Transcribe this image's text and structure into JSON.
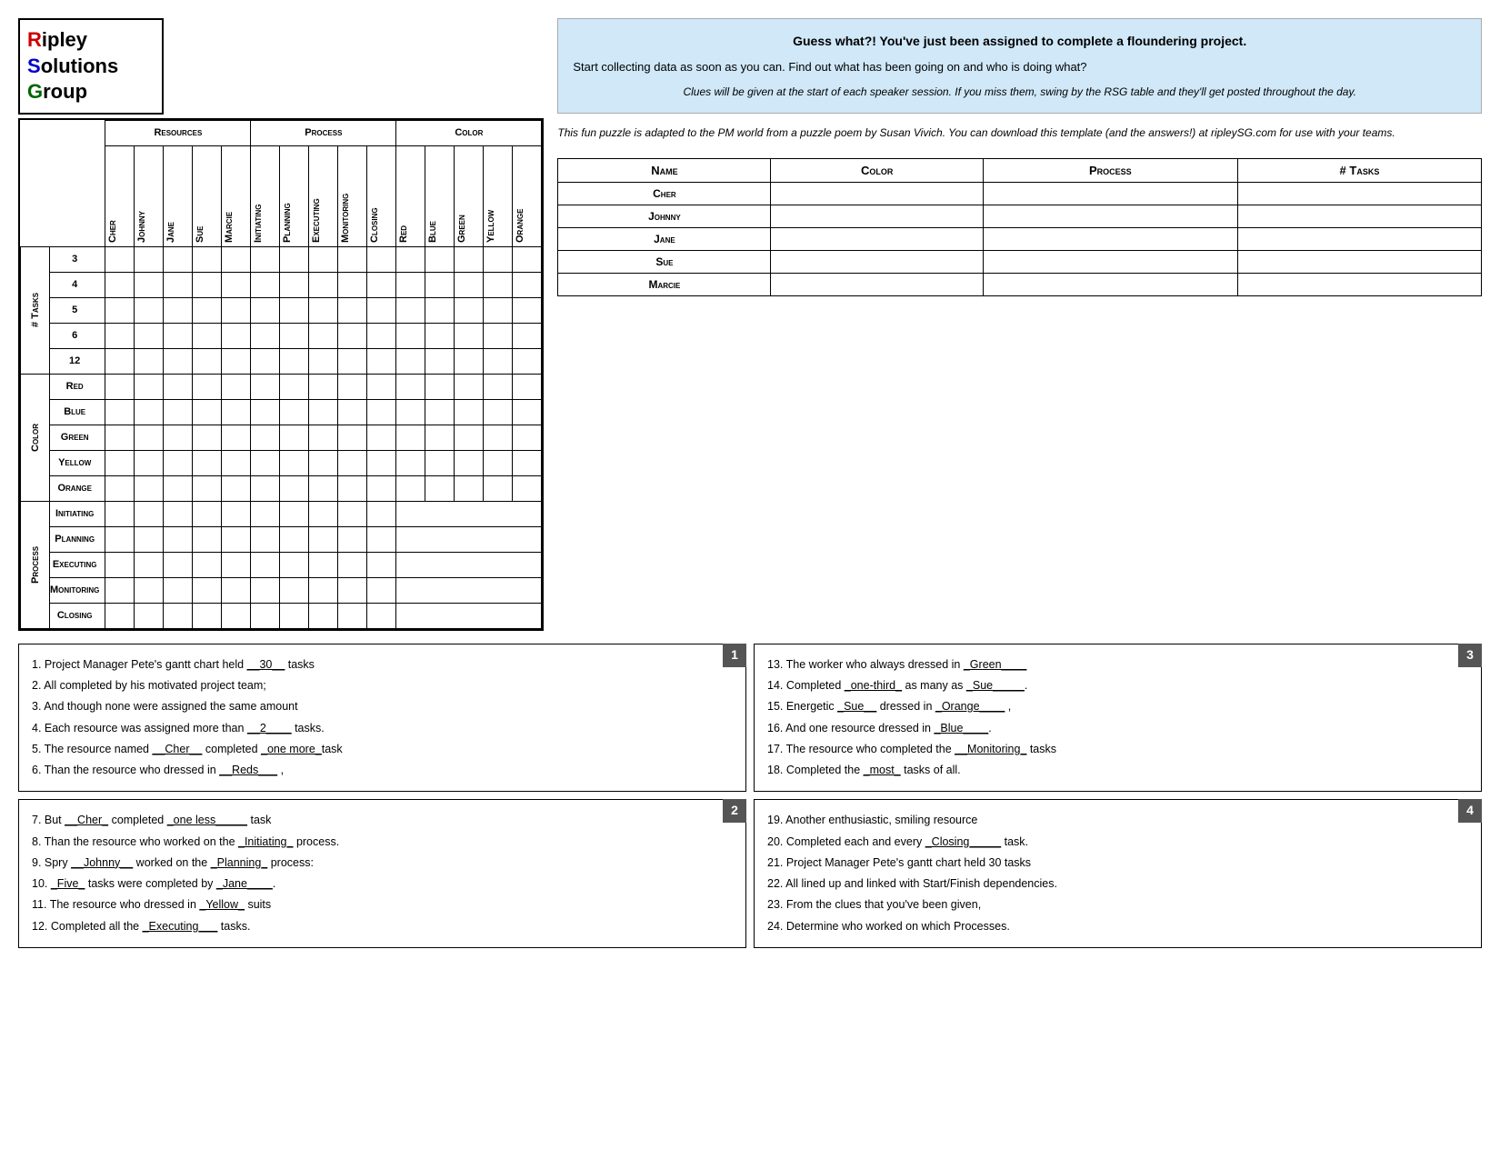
{
  "logo": {
    "line1": "ipley",
    "line2": "olutions",
    "line3": "roup",
    "r": "R",
    "s": "S",
    "g": "G"
  },
  "headers": {
    "resources": "Resources",
    "process": "Process",
    "color": "Color"
  },
  "columns": {
    "resources": [
      "Cher",
      "Johnny",
      "Jane",
      "Sue",
      "Marcie"
    ],
    "process": [
      "Initiating",
      "Planning",
      "Executing",
      "Monitoring",
      "Closing"
    ],
    "color": [
      "Red",
      "Blue",
      "Green",
      "Yellow",
      "Orange"
    ]
  },
  "row_sections": {
    "tasks": {
      "label": "# Tasks",
      "rows": [
        "3",
        "4",
        "5",
        "6",
        "12"
      ]
    },
    "color": {
      "label": "Color",
      "rows": [
        "Red",
        "Blue",
        "Green",
        "Yellow",
        "Orange"
      ]
    },
    "process": {
      "label": "Process",
      "rows": [
        "Initiating",
        "Planning",
        "Executing",
        "Monitoring",
        "Closing"
      ]
    }
  },
  "info_box": {
    "title": "Guess what?! You've just been assigned to complete a floundering project.",
    "body1": "Start collecting data as soon as you can.  Find out what has been going on and who is doing what?",
    "italic1": "Clues will be given at the start of each speaker session.  If you miss them, swing by the RSG table and they'll get posted throughout the day.",
    "italic2": "This fun puzzle is adapted to the PM world from a puzzle poem by Susan Vivich.  You can download this template (and the answers!) at ripleySG.com for use with your teams."
  },
  "summary_table": {
    "headers": [
      "Name",
      "Color",
      "Process",
      "# Tasks"
    ],
    "rows": [
      {
        "name": "Cher"
      },
      {
        "name": "Johnny"
      },
      {
        "name": "Jane"
      },
      {
        "name": "Sue"
      },
      {
        "name": "Marcie"
      }
    ]
  },
  "clues": {
    "box1": {
      "number": "1",
      "items": [
        "1.  Project Manager Pete's gantt chart held __30__ tasks",
        "2.  All completed by his motivated project team;",
        "3.  And though none were assigned the same amount",
        "4.  Each resource was assigned more than __2____ tasks.",
        "5.  The resource named __Cher__ completed _one more_task",
        "6.  Than the resource who dressed in __Reds___ ,"
      ]
    },
    "box2": {
      "number": "2",
      "items": [
        "7.  But __Cher_ completed _one less_____ task",
        "8.  Than the resource who worked on the _Initiating_ process.",
        "9.  Spry __Johnny__ worked on the _Planning_ process:",
        "10. _Five_ tasks were completed by _Jane____.",
        "11. The resource who dressed in _Yellow_ suits",
        "12. Completed all the _Executing___ tasks."
      ]
    },
    "box3": {
      "number": "3",
      "items": [
        "13. The worker who always dressed in _Green____",
        "14. Completed _one-third_ as many as _Sue_____.",
        "15. Energetic _Sue__ dressed in _Orange____ ,",
        "16. And one resource dressed in _Blue____.",
        "17. The resource who completed the __Monitoring_ tasks",
        "18. Completed the _most_ tasks of all."
      ]
    },
    "box4": {
      "number": "4",
      "items": [
        "19. Another enthusiastic, smiling resource",
        "20. Completed each and every _Closing____ task.",
        "21. Project Manager Pete's gantt chart held 30 tasks",
        "22. All lined up and linked with Start/Finish dependencies.",
        "23. From the clues that you've been given,",
        "24. Determine who worked on which Processes."
      ]
    }
  }
}
